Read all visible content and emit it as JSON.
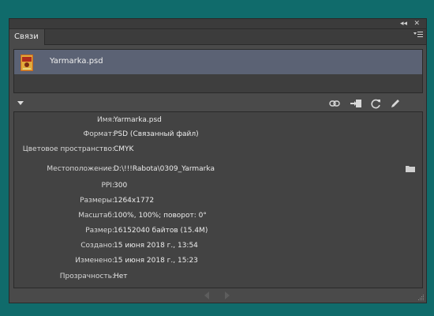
{
  "window": {
    "collapse_glyph": "◂◂",
    "close_glyph": "✕"
  },
  "tabs": [
    {
      "label": "Связи"
    }
  ],
  "panel_menu_icon": "panel-menu-icon",
  "links": [
    {
      "name": "Yarmarka.psd",
      "thumbnail_icon": "image-thumbnail-icon",
      "selected": true
    }
  ],
  "toolbar": {
    "icons": [
      "relink-icon",
      "go-to-link-icon",
      "update-link-icon",
      "edit-original-icon"
    ]
  },
  "info": [
    {
      "label": "Имя:",
      "value": "Yarmarka.psd"
    },
    {
      "label": "Формат:",
      "value": "PSD (Связанный файл)"
    },
    {
      "label": "Цветовое пространство:",
      "value": "CMYK"
    },
    {
      "label": "Местоположение:",
      "value": "D:\\!!!Rabota\\0309_Yarmarka"
    },
    {
      "label": "PPI:",
      "value": "300"
    },
    {
      "label": "Размеры:",
      "value": "1264x1772"
    },
    {
      "label": "Масштаб:",
      "value": "100%, 100%; поворот: 0°"
    },
    {
      "label": "Размер:",
      "value": "16152040 байтов (15.4M)"
    },
    {
      "label": "Создано:",
      "value": "15 июня 2018 г., 13:54"
    },
    {
      "label": "Изменено:",
      "value": "15 июня 2018 г., 15:23"
    },
    {
      "label": "Прозрачность:",
      "value": "Нет"
    }
  ],
  "colors": {
    "desktop": "#106b6b",
    "panel": "#4a4a4a",
    "selection": "#5b6274"
  }
}
